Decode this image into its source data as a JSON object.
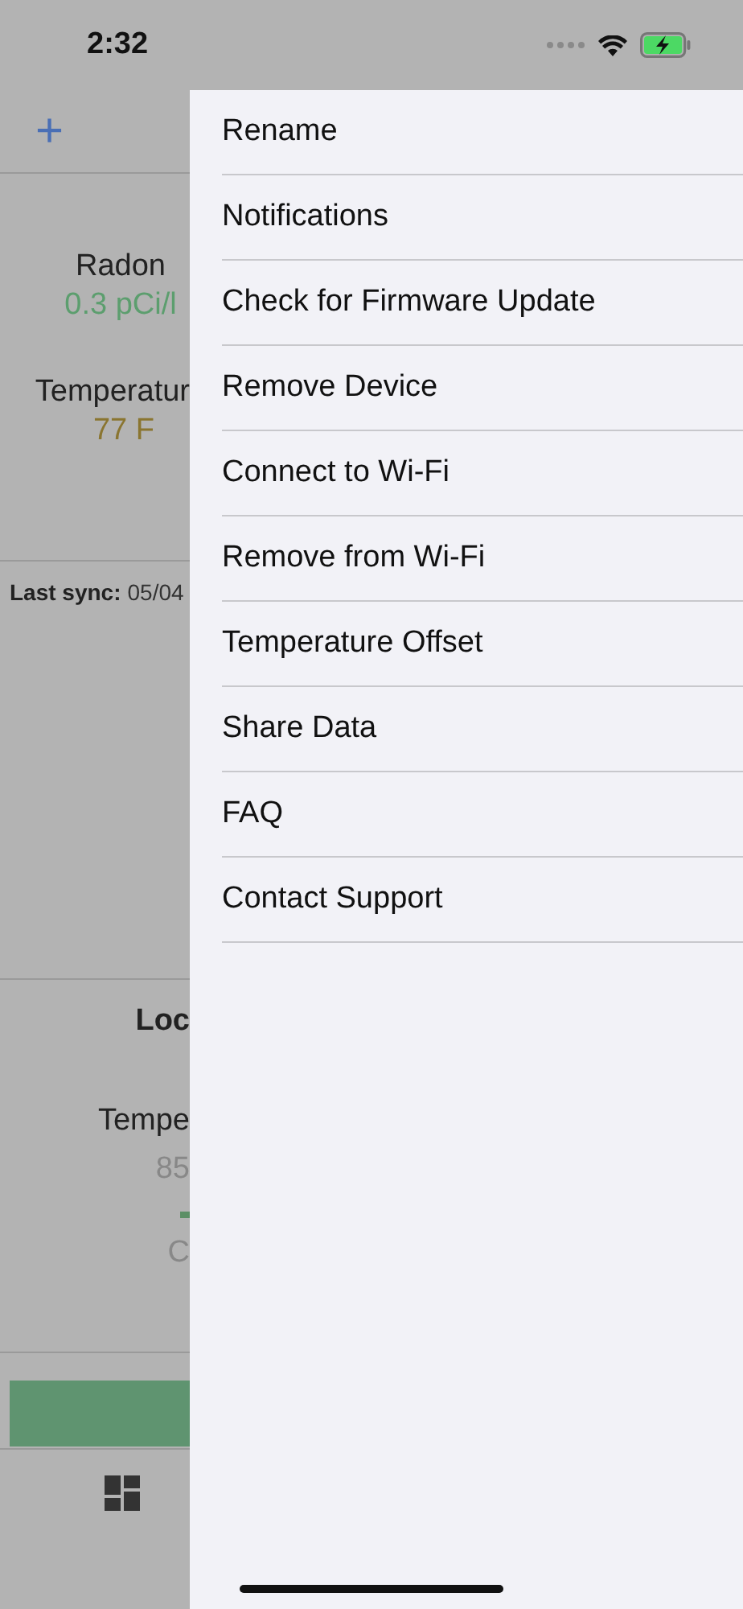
{
  "status_bar": {
    "time": "2:32"
  },
  "background": {
    "add_button": "+",
    "readings": [
      {
        "label": "Radon",
        "value": "0.3 pCi/l",
        "color": "#5c9e6e"
      },
      {
        "label": "Temperatur",
        "value": "77 F",
        "color": "#8a7530"
      }
    ],
    "last_sync": {
      "label": "Last sync:",
      "value": "05/04"
    },
    "section": {
      "title": "Loc",
      "label": "Tempe",
      "value": "85",
      "caption": "C"
    }
  },
  "menu": {
    "items": [
      {
        "label": "Rename"
      },
      {
        "label": "Notifications"
      },
      {
        "label": "Check for Firmware Update"
      },
      {
        "label": "Remove Device"
      },
      {
        "label": "Connect to Wi-Fi"
      },
      {
        "label": "Remove from Wi-Fi"
      },
      {
        "label": "Temperature Offset"
      },
      {
        "label": "Share Data"
      },
      {
        "label": "FAQ"
      },
      {
        "label": "Contact Support"
      }
    ]
  }
}
